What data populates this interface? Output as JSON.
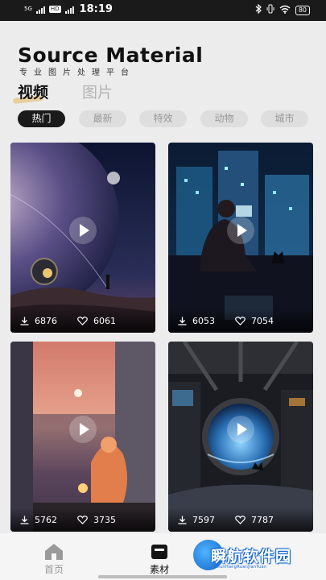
{
  "status_bar": {
    "network": "5G",
    "hd_label": "HD",
    "time": "18:19",
    "battery": "80"
  },
  "header": {
    "title": "Source Material",
    "subtitle": "专业图片处理平台"
  },
  "main_tabs": [
    {
      "label": "视频",
      "active": true
    },
    {
      "label": "图片",
      "active": false
    }
  ],
  "categories": [
    {
      "label": "热门",
      "active": true
    },
    {
      "label": "最新",
      "active": false
    },
    {
      "label": "特效",
      "active": false
    },
    {
      "label": "动物",
      "active": false
    },
    {
      "label": "城市",
      "active": false
    }
  ],
  "videos": [
    {
      "downloads": "6876",
      "likes": "6061"
    },
    {
      "downloads": "6053",
      "likes": "7054"
    },
    {
      "downloads": "5762",
      "likes": "3735"
    },
    {
      "downloads": "7597",
      "likes": "7787"
    }
  ],
  "bottom_nav": [
    {
      "label": "首页",
      "icon": "home-icon",
      "active": false
    },
    {
      "label": "素材",
      "icon": "material-icon",
      "active": true
    }
  ],
  "watermark": {
    "text": "瞬航软件园",
    "subtext": "ShunHangRuanJianYuan"
  },
  "colors": {
    "background": "#ececec",
    "accent_underline": "#e8cf9c",
    "chip_active": "#1b1b1b",
    "chip_inactive": "#dedede"
  }
}
